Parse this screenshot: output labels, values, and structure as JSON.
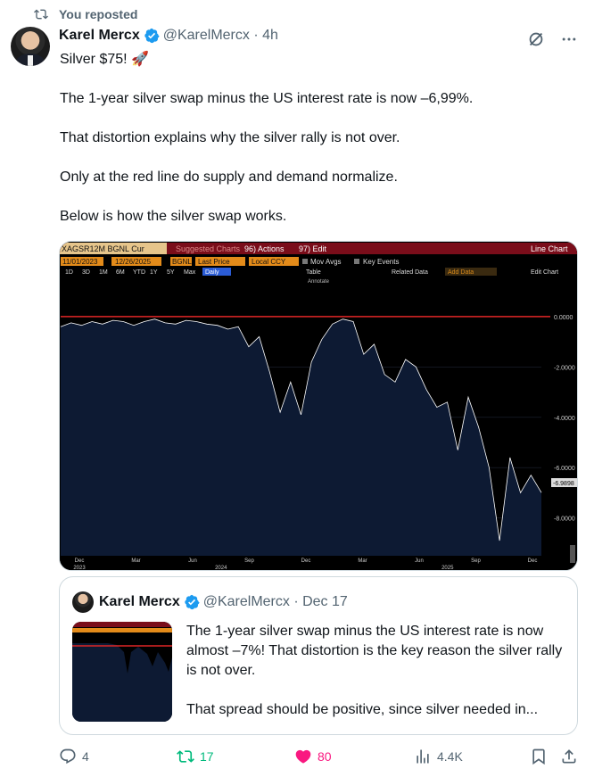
{
  "repost": {
    "label": "You reposted"
  },
  "author": {
    "name": "Karel Mercx",
    "handle": "@KarelMercx",
    "time": "4h"
  },
  "tweet": {
    "line1": "Silver $75! 🚀",
    "line2": "The 1-year silver swap minus the US interest rate is now –6,99%.",
    "line3": "That distortion explains why the silver rally is not over.",
    "line4": "Only at the red line do supply and demand normalize.",
    "line5": "Below is how the silver swap works."
  },
  "chart_terminal": {
    "ticker": "XAGSR12M BGNL Cur",
    "suggested": "Suggested Charts",
    "actions": "96) Actions",
    "edit": "97) Edit",
    "line_chart": "Line Chart",
    "date_from": "11/01/2023",
    "date_to": "12/26/2025",
    "source": "BGNL",
    "field": "Last Price",
    "currency": "Local CCY",
    "mov_avgs": "Mov Avgs",
    "key_events": "Key Events",
    "periods": [
      "1D",
      "3D",
      "1M",
      "6M",
      "YTD",
      "1Y",
      "5Y",
      "Max"
    ],
    "frequency": "Daily",
    "table": "Table",
    "annotate": "Annotate",
    "related": "Related Data",
    "add_data": "Add Data",
    "edit_chart": "Edit Chart",
    "last_value": "-6.9898"
  },
  "chart_data": {
    "type": "area",
    "series": [
      {
        "values": [
          -0.4,
          -0.25,
          -0.35,
          -0.2,
          -0.3,
          -0.15,
          -0.2,
          -0.35,
          -0.2,
          -0.1,
          -0.25,
          -0.3,
          -0.15,
          -0.2,
          -0.3,
          -0.35,
          -0.5,
          -0.4,
          -1.2,
          -0.8,
          -2.2,
          -3.8,
          -2.6,
          -3.9,
          -1.8,
          -0.9,
          -0.3,
          -0.1,
          -0.2,
          -1.5,
          -1.1,
          -2.3,
          -2.6,
          -1.7,
          -2.0,
          -2.9,
          -3.6,
          -3.4,
          -5.3,
          -3.2,
          -4.4,
          -6.0,
          -8.9,
          -5.6,
          -7.0,
          -6.3,
          -6.99
        ]
      }
    ],
    "y_ticks": [
      "0.0000",
      "-2.0000",
      "-4.0000",
      "-6.0000",
      "-8.0000"
    ],
    "ylim": [
      -9.5,
      1.2
    ],
    "x_ticks": [
      "Dec",
      "Mar",
      "Jun",
      "Sep",
      "Dec",
      "Mar",
      "Jun",
      "Sep",
      "Dec"
    ],
    "x_years": [
      "2023",
      "2024",
      "2025"
    ],
    "reference_line": 0,
    "colors": {
      "fill": "#0d1a33",
      "line": "#ffffff",
      "reference": "#e02626"
    }
  },
  "quote": {
    "name": "Karel Mercx",
    "handle": "@KarelMercx",
    "date": "Dec 17",
    "text1": "The 1-year silver swap minus the US interest rate is now almost –7%! That distortion is the key reason the silver rally is not over.",
    "text2": "That spread should be positive, since silver needed in..."
  },
  "actions": {
    "replies": "4",
    "reposts": "17",
    "likes": "80",
    "views": "4.4K"
  },
  "colors": {
    "verified": "#1d9bf0",
    "repost_green": "#00ba7c",
    "like_pink": "#f91880",
    "muted": "#536471"
  }
}
